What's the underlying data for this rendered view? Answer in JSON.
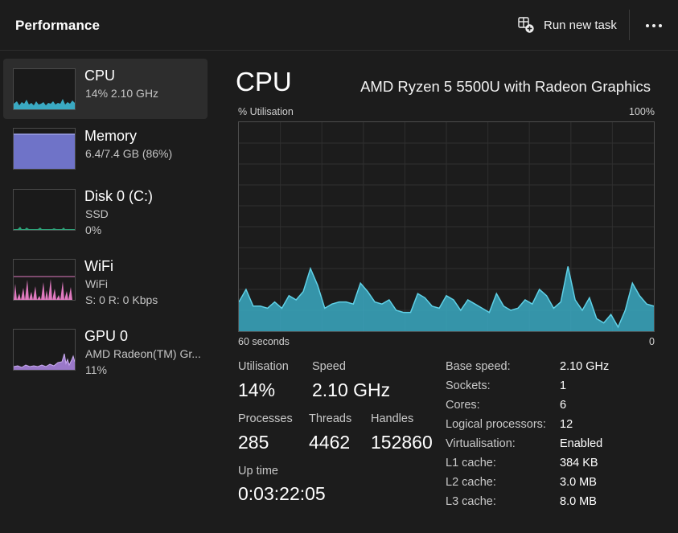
{
  "header": {
    "title": "Performance",
    "run_task_label": "Run new task",
    "run_task_icon": "run-task-icon",
    "more_icon": "more-options-icon"
  },
  "sidebar": {
    "items": [
      {
        "name": "CPU",
        "sub1": "14%  2.10 GHz",
        "sub2": "",
        "color": "#3aa9c2",
        "selected": true
      },
      {
        "name": "Memory",
        "sub1": "6.4/7.4 GB (86%)",
        "sub2": "",
        "color": "#6f73c8",
        "selected": false
      },
      {
        "name": "Disk 0 (C:)",
        "sub1": "SSD",
        "sub2": "0%",
        "color": "#2fa37a",
        "selected": false
      },
      {
        "name": "WiFi",
        "sub1": "WiFi",
        "sub2": "S: 0  R: 0 Kbps",
        "color": "#e07ac0",
        "selected": false
      },
      {
        "name": "GPU 0",
        "sub1": "AMD Radeon(TM) Gr...",
        "sub2": "11%",
        "color": "#9a78c9",
        "selected": false
      }
    ]
  },
  "main": {
    "title": "CPU",
    "model": "AMD Ryzen 5 5500U with Radeon Graphics",
    "graph": {
      "y_label": "% Utilisation",
      "y_max_label": "100%",
      "x_left_label": "60 seconds",
      "x_right_label": "0",
      "color": "#3aa9c2",
      "utilisation_series": [
        14,
        20,
        12,
        12,
        11,
        14,
        11,
        17,
        15,
        19,
        30,
        22,
        11,
        13,
        14,
        14,
        13,
        23,
        19,
        14,
        13,
        15,
        10,
        9,
        9,
        18,
        16,
        12,
        11,
        17,
        15,
        10,
        15,
        13,
        11,
        9,
        18,
        12,
        10,
        11,
        15,
        13,
        20,
        17,
        11,
        14,
        31,
        15,
        10,
        16,
        6,
        4,
        8,
        2,
        10,
        23,
        17,
        13,
        12
      ]
    },
    "stats": {
      "utilisation_label": "Utilisation",
      "utilisation_value": "14%",
      "speed_label": "Speed",
      "speed_value": "2.10 GHz",
      "processes_label": "Processes",
      "processes_value": "285",
      "threads_label": "Threads",
      "threads_value": "4462",
      "handles_label": "Handles",
      "handles_value": "152860",
      "uptime_label": "Up time",
      "uptime_value": "0:03:22:05"
    },
    "specs": [
      {
        "key": "Base speed:",
        "value": "2.10 GHz"
      },
      {
        "key": "Sockets:",
        "value": "1"
      },
      {
        "key": "Cores:",
        "value": "6"
      },
      {
        "key": "Logical processors:",
        "value": "12"
      },
      {
        "key": "Virtualisation:",
        "value": "Enabled"
      },
      {
        "key": "L1 cache:",
        "value": "384 KB"
      },
      {
        "key": "L2 cache:",
        "value": "3.0 MB"
      },
      {
        "key": "L3 cache:",
        "value": "8.0 MB"
      }
    ]
  }
}
